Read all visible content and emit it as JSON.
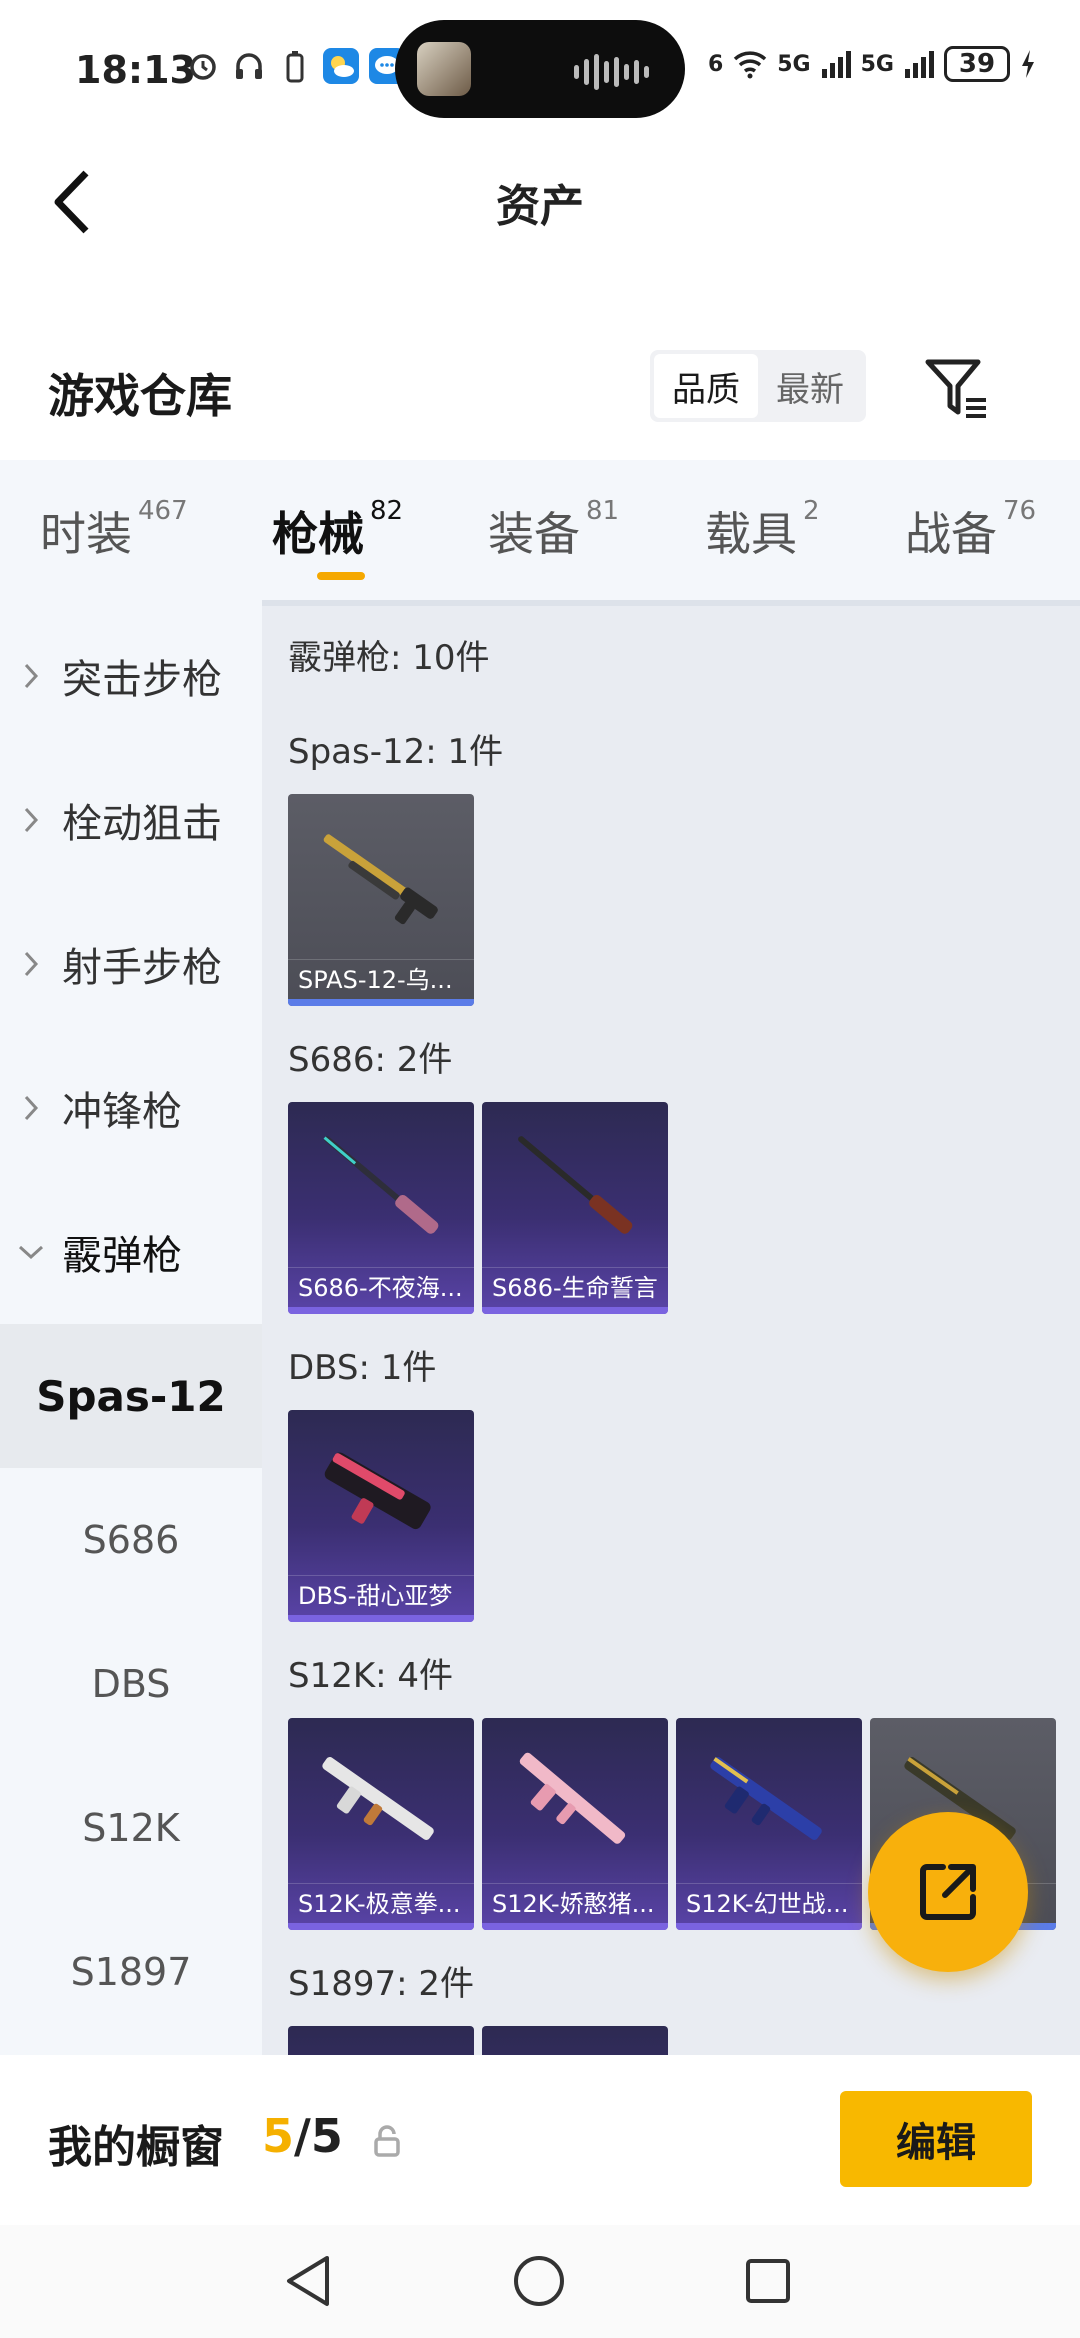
{
  "status_bar": {
    "time": "18:13",
    "network_5g_a": "5G",
    "network_5g_b": "5G",
    "wifi_badge": "6",
    "battery": "39"
  },
  "header": {
    "title": "资产"
  },
  "warehouse": {
    "title": "游戏仓库",
    "sort_options": [
      "品质",
      "最新"
    ],
    "sort_selected": "品质"
  },
  "tabs": [
    {
      "label": "时装",
      "count": "467"
    },
    {
      "label": "枪械",
      "count": "82"
    },
    {
      "label": "装备",
      "count": "81"
    },
    {
      "label": "载具",
      "count": "2"
    },
    {
      "label": "战备",
      "count": "76"
    }
  ],
  "sidebar": {
    "categories": [
      {
        "label": "突击步枪"
      },
      {
        "label": "栓动狙击"
      },
      {
        "label": "射手步枪"
      },
      {
        "label": "冲锋枪"
      },
      {
        "label": "霰弹枪"
      }
    ],
    "subitems": [
      {
        "label": "Spas-12"
      },
      {
        "label": "S686"
      },
      {
        "label": "DBS"
      },
      {
        "label": "S12K"
      },
      {
        "label": "S1897"
      }
    ]
  },
  "content": {
    "summary": "霰弹枪: 10件",
    "groups": [
      {
        "title": "Spas-12: 1件",
        "items": [
          "SPAS-12-乌..."
        ]
      },
      {
        "title": "S686: 2件",
        "items": [
          "S686-不夜海...",
          "S686-生命誓言"
        ]
      },
      {
        "title": "DBS: 1件",
        "items": [
          "DBS-甜心亚梦"
        ]
      },
      {
        "title": "S12K: 4件",
        "items": [
          "S12K-极意拳...",
          "S12K-娇憨猪...",
          "S12K-幻世战...",
          "..."
        ]
      },
      {
        "title": "S1897: 2件",
        "items": []
      }
    ]
  },
  "bottom": {
    "showcase_label": "我的橱窗",
    "showcase_current": "5",
    "showcase_total": "/5",
    "edit_label": "编辑"
  },
  "colors": {
    "accent": "#f8b800",
    "purple_card": "#3b2f72",
    "gray_card": "#55565f"
  }
}
